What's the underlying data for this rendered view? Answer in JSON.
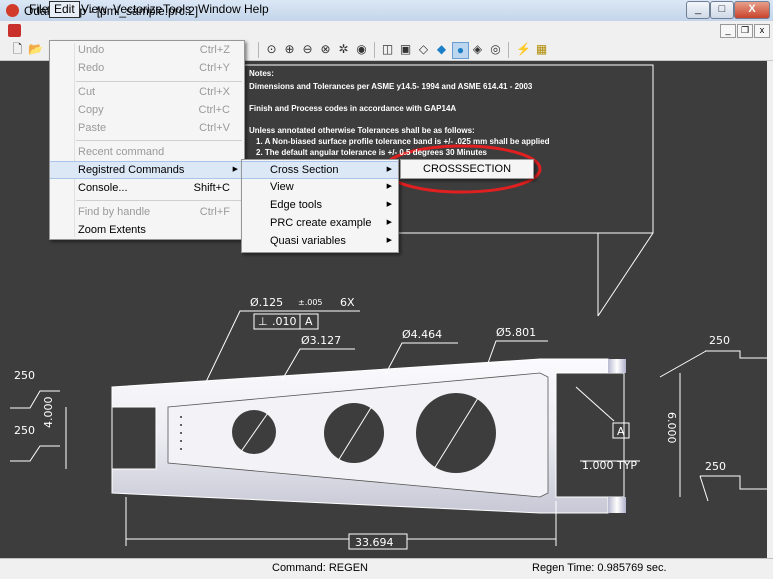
{
  "window": {
    "title": "OdaPrcApp - [pmi_sample.prc:2]",
    "controls": [
      "_",
      "□",
      "X"
    ],
    "mdi_controls": [
      "_",
      "❐",
      "x"
    ]
  },
  "menubar": {
    "items": [
      "File",
      "Edit",
      "View",
      "Vectorize",
      "Tools",
      "Window",
      "Help"
    ]
  },
  "edit_menu": {
    "items": [
      {
        "label": "Undo",
        "shortcut": "Ctrl+Z",
        "enabled": false
      },
      {
        "label": "Redo",
        "shortcut": "Ctrl+Y",
        "enabled": false
      },
      {
        "label": "Cut",
        "shortcut": "Ctrl+X",
        "enabled": false
      },
      {
        "label": "Copy",
        "shortcut": "Ctrl+C",
        "enabled": false
      },
      {
        "label": "Paste",
        "shortcut": "Ctrl+V",
        "enabled": false
      },
      {
        "label": "Recent command",
        "shortcut": "",
        "enabled": false
      },
      {
        "label": "Registred Commands",
        "shortcut": "",
        "enabled": true
      },
      {
        "label": "Console...",
        "shortcut": "Shift+C",
        "enabled": true
      },
      {
        "label": "Find by handle",
        "shortcut": "Ctrl+F",
        "enabled": false
      },
      {
        "label": "Zoom Extents",
        "shortcut": "",
        "enabled": true
      }
    ]
  },
  "submenu": {
    "items": [
      "Cross Section",
      "View",
      "Edge tools",
      "PRC create example",
      "Quasi variables"
    ]
  },
  "crosssection_item": "CROSSSECTION",
  "notes": {
    "lines": [
      "Notes:",
      "Dimensions and Tolerances per ASME y14.5- 1994 and ASME 614.41 - 2003",
      "Finish and Process codes in accordance with GAP14A",
      "Unless annotated otherwise Tolerances shall be as follows:",
      "1. A Non-biased surface profile tolerance band is +/- .025 mm shall be applied",
      "2. The default angular tolerance is +/- 0.5 degrees 30 Minutes"
    ]
  },
  "dimensions": {
    "hole_dia": "Ø.125",
    "hole_tol": "±.005",
    "hole_count": "6X",
    "flatness_value": ".010",
    "flatness_datum": "A",
    "dia1": "Ø3.127",
    "dia2": "Ø4.464",
    "dia3": "Ø5.801",
    "left_top": "250",
    "left_mid": "250",
    "left_height": "4.000",
    "right_top": "250",
    "right_bottom": "250",
    "right_height": "6.000",
    "datum_right": "A",
    "typ": "1.000 TYP",
    "length": "33.694"
  },
  "status": {
    "command": "Command: REGEN",
    "regen": "Regen Time: 0.985769 sec."
  },
  "colors": {
    "canvas": "#3d3d3d",
    "highlight_ring": "#e02020",
    "part_fill": "#ececf2"
  }
}
